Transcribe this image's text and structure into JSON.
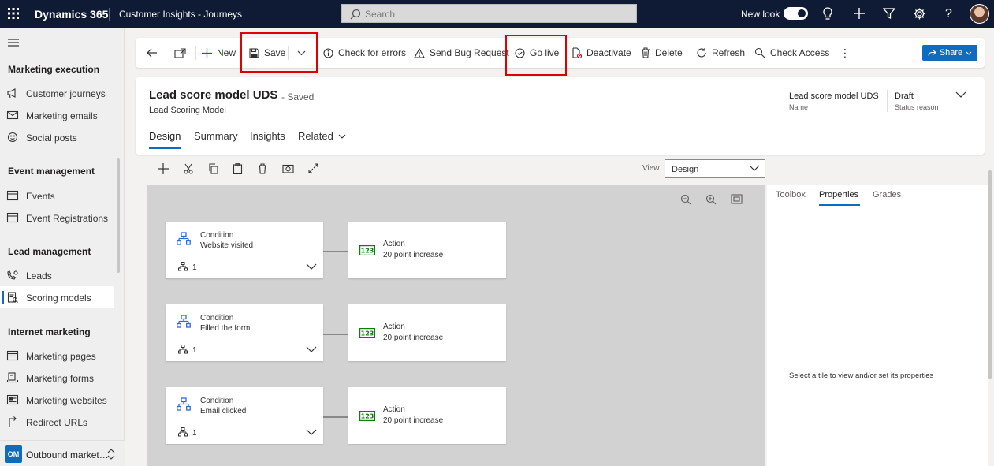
{
  "topbar": {
    "brand": "Dynamics 365",
    "app_name": "Customer Insights - Journeys",
    "search_placeholder": "Search",
    "new_look_label": "New look",
    "new_look_enabled": true
  },
  "sidebar": {
    "sections": [
      {
        "title": "Marketing execution",
        "items": [
          {
            "label": "Customer journeys",
            "icon": "megaphone-icon"
          },
          {
            "label": "Marketing emails",
            "icon": "mail-icon"
          },
          {
            "label": "Social posts",
            "icon": "emoji-icon"
          }
        ]
      },
      {
        "title": "Event management",
        "items": [
          {
            "label": "Events",
            "icon": "calendar-icon"
          },
          {
            "label": "Event Registrations",
            "icon": "calendar-icon"
          }
        ]
      },
      {
        "title": "Lead management",
        "items": [
          {
            "label": "Leads",
            "icon": "phone-person-icon"
          },
          {
            "label": "Scoring models",
            "icon": "scoring-doc-icon",
            "selected": true
          }
        ]
      },
      {
        "title": "Internet marketing",
        "items": [
          {
            "label": "Marketing pages",
            "icon": "page-icon"
          },
          {
            "label": "Marketing forms",
            "icon": "form-icon"
          },
          {
            "label": "Marketing websites",
            "icon": "website-icon"
          },
          {
            "label": "Redirect URLs",
            "icon": "redirect-icon"
          }
        ]
      }
    ],
    "area": {
      "badge": "OM",
      "name": "Outbound market…"
    }
  },
  "commands": {
    "new": "New",
    "save": "Save",
    "check_errors": "Check for errors",
    "send_bug": "Send Bug Request",
    "go_live": "Go live",
    "deactivate": "Deactivate",
    "delete": "Delete",
    "refresh": "Refresh",
    "check_access": "Check Access",
    "share": "Share"
  },
  "record": {
    "title": "Lead score model UDS",
    "save_state": "- Saved",
    "entity": "Lead Scoring Model",
    "header_fields": {
      "name_value": "Lead score model UDS",
      "name_label": "Name",
      "status_value": "Draft",
      "status_label": "Status reason"
    },
    "tabs": [
      "Design",
      "Summary",
      "Insights",
      "Related"
    ],
    "selected_tab": "Design"
  },
  "designer": {
    "view_label": "View",
    "view_value": "Design",
    "rows": [
      {
        "condition_type": "Condition",
        "condition_name": "Website visited",
        "branch_count": "1",
        "action_type": "Action",
        "action_name": "20 point increase"
      },
      {
        "condition_type": "Condition",
        "condition_name": "Filled the form",
        "branch_count": "1",
        "action_type": "Action",
        "action_name": "20 point increase"
      },
      {
        "condition_type": "Condition",
        "condition_name": "Email clicked",
        "branch_count": "1",
        "action_type": "Action",
        "action_name": "20 point increase"
      }
    ]
  },
  "panel": {
    "tabs": [
      "Toolbox",
      "Properties",
      "Grades"
    ],
    "selected_tab": "Properties",
    "hint": "Select a tile to view and/or set its properties"
  },
  "colors": {
    "topbar": "#0f1b35",
    "accent": "#0f6cbd",
    "highlight": "#e00000",
    "canvas": "#d2d2d2"
  }
}
